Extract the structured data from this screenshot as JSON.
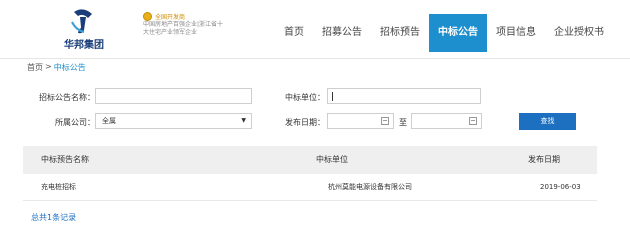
{
  "brand": {
    "name": "华邦集团",
    "cert_line1": "全国开发商",
    "cert_line2": "中国房地产百强企业|浙江省十",
    "cert_line3": "大住宅产业领军企业"
  },
  "nav": {
    "items": [
      {
        "label": "首页",
        "active": false
      },
      {
        "label": "招募公告",
        "active": false
      },
      {
        "label": "招标预告",
        "active": false
      },
      {
        "label": "中标公告",
        "active": true
      },
      {
        "label": "项目信息",
        "active": false
      },
      {
        "label": "企业授权书",
        "active": false
      }
    ]
  },
  "breadcrumb": {
    "home": "首页",
    "separator": ">",
    "current": "中标公告"
  },
  "form": {
    "notice_name_label": "招标公告名称：",
    "notice_name_value": "",
    "winner_label": "中标单位：",
    "winner_value": "",
    "company_label": "所属公司：",
    "company_value": "全属",
    "date_label": "发布日期：",
    "date_start": "",
    "date_to": "至",
    "date_end": "",
    "search_button": "查找"
  },
  "table": {
    "headers": [
      "中标预告名称",
      "中标单位",
      "发布日期"
    ],
    "rows": [
      [
        "充电桩招标",
        "杭州莫能电源设备有限公司",
        "2019-06-03"
      ]
    ]
  },
  "footer": {
    "total": "总共1条记录"
  },
  "colors": {
    "accent": "#1d8fce",
    "button": "#1d6fc0",
    "brand": "#1a3e7a"
  }
}
